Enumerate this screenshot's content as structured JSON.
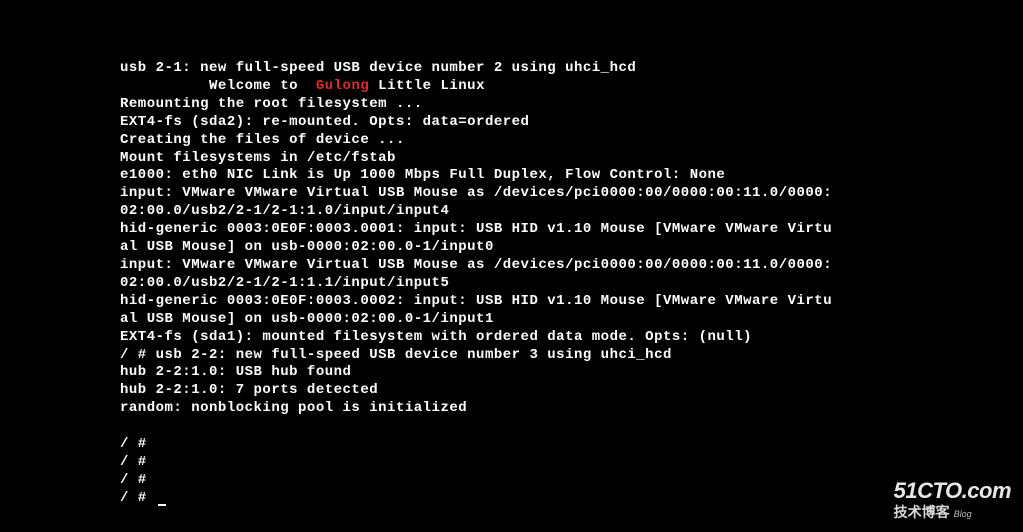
{
  "terminal": {
    "lines_before_welcome": [
      "usb 2-1: new full-speed USB device number 2 using uhci_hcd"
    ],
    "welcome": {
      "prefix": "          Welcome to  ",
      "brand": "Gulong",
      "suffix": " Little Linux"
    },
    "lines_after_welcome": [
      "Remounting the root filesystem ...",
      "EXT4-fs (sda2): re-mounted. Opts: data=ordered",
      "Creating the files of device ...",
      "Mount filesystems in /etc/fstab",
      "e1000: eth0 NIC Link is Up 1000 Mbps Full Duplex, Flow Control: None",
      "input: VMware VMware Virtual USB Mouse as /devices/pci0000:00/0000:00:11.0/0000:",
      "02:00.0/usb2/2-1/2-1:1.0/input/input4",
      "hid-generic 0003:0E0F:0003.0001: input: USB HID v1.10 Mouse [VMware VMware Virtu",
      "al USB Mouse] on usb-0000:02:00.0-1/input0",
      "input: VMware VMware Virtual USB Mouse as /devices/pci0000:00/0000:00:11.0/0000:",
      "02:00.0/usb2/2-1/2-1:1.1/input/input5",
      "hid-generic 0003:0E0F:0003.0002: input: USB HID v1.10 Mouse [VMware VMware Virtu",
      "al USB Mouse] on usb-0000:02:00.0-1/input1",
      "EXT4-fs (sda1): mounted filesystem with ordered data mode. Opts: (null)",
      "/ # usb 2-2: new full-speed USB device number 3 using uhci_hcd",
      "hub 2-2:1.0: USB hub found",
      "hub 2-2:1.0: 7 ports detected",
      "random: nonblocking pool is initialized",
      "",
      "/ #",
      "/ #",
      "/ #"
    ],
    "prompt": "/ # "
  },
  "watermark": {
    "top": "51CTO.com",
    "bottom": "技术博客",
    "blog": "Blog"
  }
}
